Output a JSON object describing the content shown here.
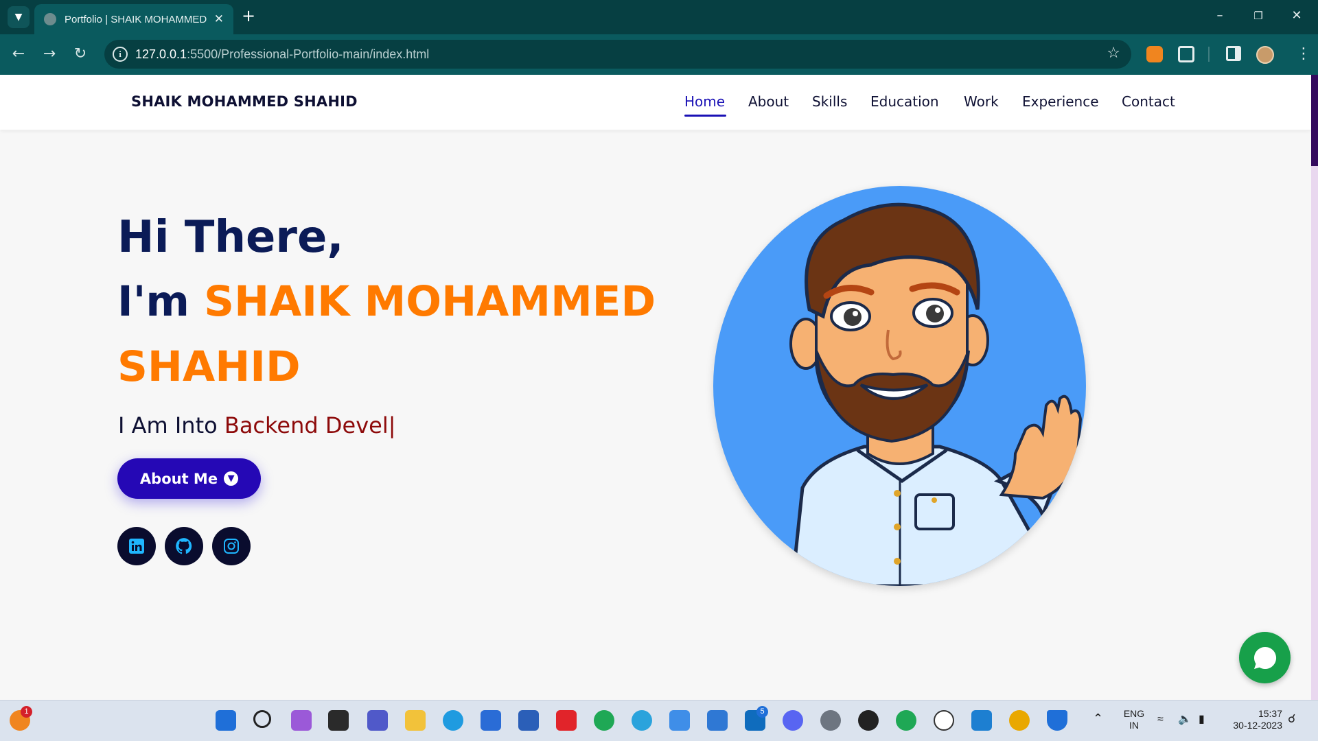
{
  "browser": {
    "tab_title": "Portfolio | SHAIK MOHAMMED",
    "url_host": "127.0.0.1",
    "url_path": ":5500/Professional-Portfolio-main/index.html"
  },
  "site": {
    "brand": "SHAIK MOHAMMED SHAHID",
    "nav": [
      {
        "label": "Home",
        "active": true
      },
      {
        "label": "About"
      },
      {
        "label": "Skills"
      },
      {
        "label": "Education"
      },
      {
        "label": "Work"
      },
      {
        "label": "Experience"
      },
      {
        "label": "Contact"
      }
    ]
  },
  "hero": {
    "greeting": "Hi There,",
    "im_prefix": "I'm ",
    "name_line1": "SHAIK MOHAMMED",
    "name_line2": "SHAHID",
    "into_prefix": "I Am Into ",
    "typed_text": "Backend Devel|",
    "cta_label": "About Me",
    "socials": [
      "linkedin",
      "github",
      "instagram"
    ]
  },
  "taskbar": {
    "notification_badge": "1",
    "outlook_badge": "5",
    "language": "ENG",
    "region": "IN",
    "time": "15:37",
    "date": "30-12-2023"
  },
  "colors": {
    "accent_blue": "#1a11b5",
    "name_orange": "#ff7a00",
    "typed_red": "#8d0a0a",
    "heading_navy": "#0b1b57"
  }
}
